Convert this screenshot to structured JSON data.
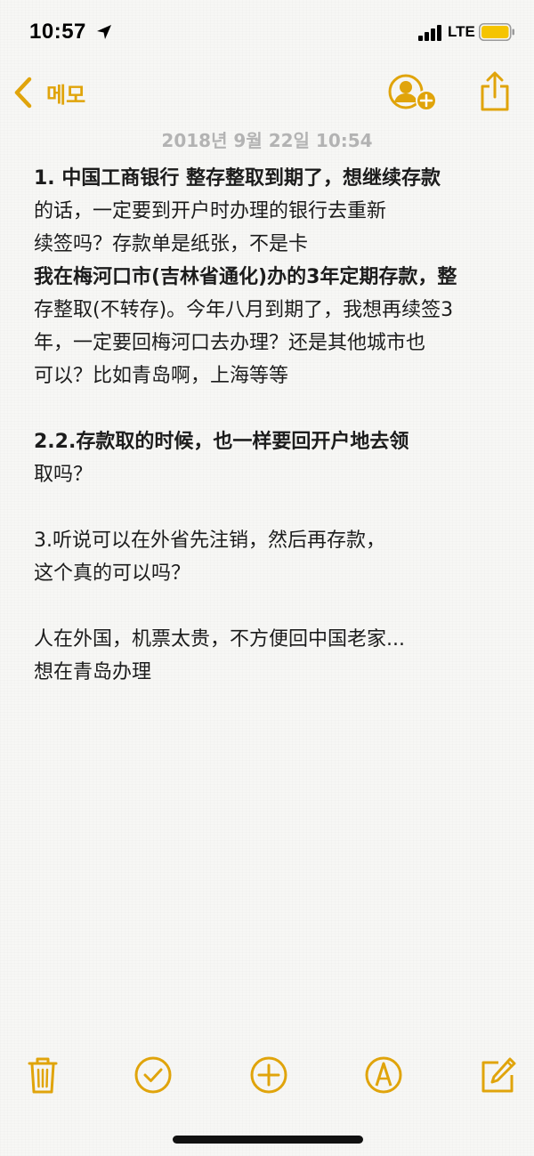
{
  "status_bar": {
    "time": "10:57",
    "network": "LTE"
  },
  "nav": {
    "back_label": "메모"
  },
  "note": {
    "date": "2018년 9월 22일 10:54",
    "lines": [
      {
        "text": "1. 中国工商银行 整存整取到期了，想继续存款",
        "bold": true
      },
      {
        "text": "的话，一定要到开户时办理的银行去重新",
        "bold": false
      },
      {
        "text": "续签吗？存款单是纸张，不是卡",
        "bold": false
      },
      {
        "text": "我在梅河口市(吉林省通化)办的3年定期存款，整",
        "bold": true
      },
      {
        "text": "存整取(不转存)。今年八月到期了，我想再续签3",
        "bold": false
      },
      {
        "text": "年，一定要回梅河口去办理？还是其他城市也",
        "bold": false
      },
      {
        "text": "可以？比如青岛啊，上海等等",
        "bold": false
      },
      {
        "text": "",
        "bold": false
      },
      {
        "text": "2.2.存款取的时候，也一样要回开户地去领",
        "bold": true
      },
      {
        "text": "取吗？",
        "bold": false
      },
      {
        "text": "",
        "bold": false
      },
      {
        "text": "3.听说可以在外省先注销，然后再存款，",
        "bold": false
      },
      {
        "text": "这个真的可以吗？",
        "bold": false
      },
      {
        "text": "",
        "bold": false
      },
      {
        "text": "人在外国，机票太贵，不方便回中国老家...",
        "bold": false
      },
      {
        "text": "想在青岛办理",
        "bold": false
      }
    ]
  },
  "colors": {
    "accent": "#e0a40b",
    "date_text": "#b3b3b3",
    "body_text": "#1c1c1c",
    "battery_fill": "#f5c400"
  },
  "toolbar": {
    "icons": [
      "trash-icon",
      "checklist-icon",
      "add-icon",
      "markup-icon",
      "compose-icon"
    ]
  }
}
